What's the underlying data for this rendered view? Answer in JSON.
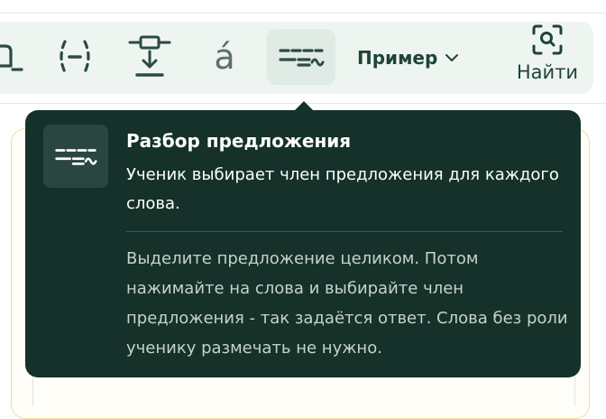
{
  "toolbar": {
    "tools": [
      {
        "icon": "subscript-box-icon"
      },
      {
        "icon": "parenthesis-dash-icon"
      },
      {
        "icon": "insert-below-icon"
      },
      {
        "icon": "accent-a-icon",
        "glyph": "á"
      },
      {
        "icon": "sentence-parse-icon",
        "active": true
      }
    ],
    "example_select": {
      "label": "Пример",
      "icon": "chevron-down-icon"
    },
    "find_button": {
      "label": "Найти",
      "icon": "scan-search-icon"
    }
  },
  "tooltip": {
    "icon": "sentence-parse-icon",
    "title": "Разбор предложения",
    "description": "Ученик выбирает член предложения для каждого слова.",
    "hint": "Выделите предложение целиком. Потом нажимайте на слова и выбирайте член предложения - так задаётся ответ. Слова без роли ученику размечать не нужно."
  },
  "colors": {
    "toolbar_bg": "#eef5f1",
    "icon": "#2b4c40",
    "tooltip_bg": "#15312a",
    "card_border": "#f1df9a"
  }
}
